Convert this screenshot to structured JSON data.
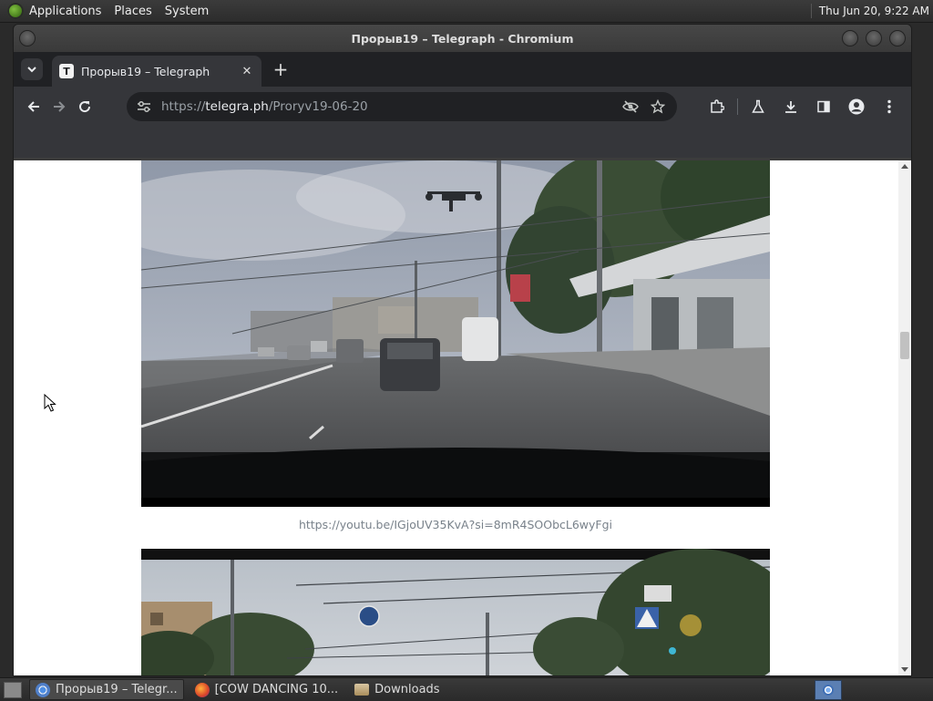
{
  "top_panel": {
    "menus": [
      "Applications",
      "Places",
      "System"
    ],
    "clock": "Thu Jun 20,  9:22 AM"
  },
  "window": {
    "title": "Прорыв19 – Telegraph - Chromium"
  },
  "tabs": [
    {
      "label": "Прорыв19 – Telegraph",
      "favicon": "T"
    }
  ],
  "toolbar": {
    "url_scheme": "https://",
    "url_host": "telegra.ph",
    "url_path": "/Proryv19-06-20"
  },
  "page": {
    "caption": "https://youtu.be/IGjoUV35KvA?si=8mR4SOObcL6wyFgi"
  },
  "taskbar": {
    "tasks": [
      {
        "label": "Прорыв19 – Telegr...",
        "icon": "chromium-icon",
        "active": true
      },
      {
        "label": "[COW DANCING 10...",
        "icon": "firefox-icon",
        "active": false
      },
      {
        "label": "Downloads",
        "icon": "folder-icon",
        "active": false
      }
    ]
  }
}
